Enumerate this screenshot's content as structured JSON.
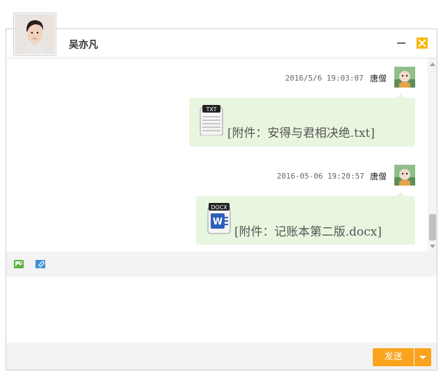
{
  "contact": {
    "name": "吴亦凡"
  },
  "messages": [
    {
      "timestamp": "2016/5/6 19:03:07",
      "sender": "唐僧",
      "file_type_label": "TXT",
      "text": "[附件：安得与君相决绝.txt]"
    },
    {
      "timestamp": "2016-05-06 19:20:57",
      "sender": "唐僧",
      "file_type_label": "DOCX",
      "text": "[附件：记账本第二版.docx]"
    }
  ],
  "toolbar": {
    "icons": [
      "image-icon",
      "attachment-icon"
    ]
  },
  "footer": {
    "send_label": "发送"
  },
  "colors": {
    "accent": "#fba31c",
    "close": "#f7b600",
    "bubble": "#e8f6df"
  }
}
